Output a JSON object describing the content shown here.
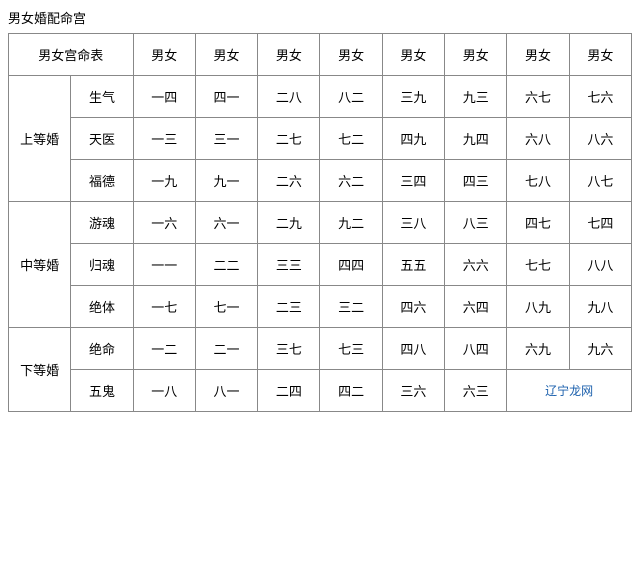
{
  "title": "男女婚配命宫",
  "table": {
    "header": {
      "col0": "男女宫命表",
      "cols": [
        "男女",
        "男女",
        "男女",
        "男女",
        "男女",
        "男女",
        "男女",
        "男女"
      ]
    },
    "sections": [
      {
        "grade": "上等婚",
        "rows": [
          {
            "name": "生气",
            "cells": [
              {
                "text": "一四",
                "red": false
              },
              {
                "text": "四一",
                "red": false
              },
              {
                "text": "二八",
                "red": true
              },
              {
                "text": "八二",
                "red": false
              },
              {
                "text": "三九",
                "red": false
              },
              {
                "text": "九三",
                "red": false
              },
              {
                "text": "六七",
                "red": false
              },
              {
                "text": "七六",
                "red": false
              }
            ]
          },
          {
            "name": "天医",
            "cells": [
              {
                "text": "一三",
                "red": false
              },
              {
                "text": "三一",
                "red": false
              },
              {
                "text": "二七",
                "red": false
              },
              {
                "text": "七二",
                "red": false
              },
              {
                "text": "四九",
                "red": false
              },
              {
                "text": "九四",
                "red": false
              },
              {
                "text": "六八",
                "red": true
              },
              {
                "text": "八六",
                "red": false
              }
            ]
          },
          {
            "name": "福德",
            "cells": [
              {
                "text": "一九",
                "red": false
              },
              {
                "text": "九一",
                "red": false
              },
              {
                "text": "二六",
                "red": false
              },
              {
                "text": "六二",
                "red": false
              },
              {
                "text": "三四",
                "red": false
              },
              {
                "text": "四三",
                "red": false
              },
              {
                "text": "七八",
                "red": true
              },
              {
                "text": "八七",
                "red": false
              }
            ]
          }
        ]
      },
      {
        "grade": "中等婚",
        "rows": [
          {
            "name": "游魂",
            "cells": [
              {
                "text": "一六",
                "red": false
              },
              {
                "text": "六一",
                "red": false
              },
              {
                "text": "二九",
                "red": false
              },
              {
                "text": "九二",
                "red": false
              },
              {
                "text": "三八",
                "red": true
              },
              {
                "text": "八三",
                "red": false
              },
              {
                "text": "四七",
                "red": false
              },
              {
                "text": "七四",
                "red": false
              }
            ]
          },
          {
            "name": "归魂",
            "cells": [
              {
                "text": "一一",
                "red": false
              },
              {
                "text": "二二",
                "red": false
              },
              {
                "text": "三三",
                "red": false
              },
              {
                "text": "四四",
                "red": false
              },
              {
                "text": "五五",
                "red": false
              },
              {
                "text": "六六",
                "red": false
              },
              {
                "text": "七七",
                "red": false
              },
              {
                "text": "八八",
                "red": true
              }
            ]
          },
          {
            "name": "绝体",
            "cells": [
              {
                "text": "一七",
                "red": false
              },
              {
                "text": "七一",
                "red": false
              },
              {
                "text": "二三",
                "red": false
              },
              {
                "text": "三二",
                "red": false
              },
              {
                "text": "四六",
                "red": false
              },
              {
                "text": "六四",
                "red": false
              },
              {
                "text": "八九",
                "red": false
              },
              {
                "text": "九八",
                "red": true
              }
            ]
          }
        ]
      },
      {
        "grade": "下等婚",
        "rows": [
          {
            "name": "绝命",
            "cells": [
              {
                "text": "一二",
                "red": false
              },
              {
                "text": "二一",
                "red": false
              },
              {
                "text": "三七",
                "red": false
              },
              {
                "text": "七三",
                "red": false
              },
              {
                "text": "四八",
                "red": true
              },
              {
                "text": "八四",
                "red": false
              },
              {
                "text": "六九",
                "red": false
              },
              {
                "text": "九六",
                "red": false
              }
            ]
          },
          {
            "name": "五鬼",
            "cells": [
              {
                "text": "一八",
                "red": true
              },
              {
                "text": "八一",
                "red": false
              },
              {
                "text": "二四",
                "red": false
              },
              {
                "text": "四二",
                "red": false
              },
              {
                "text": "三六",
                "red": false
              },
              {
                "text": "六三",
                "red": false
              },
              {
                "text": "watermark",
                "red": false
              },
              {
                "text": "",
                "red": false
              }
            ]
          }
        ]
      }
    ]
  },
  "watermark": "辽宁龙网"
}
